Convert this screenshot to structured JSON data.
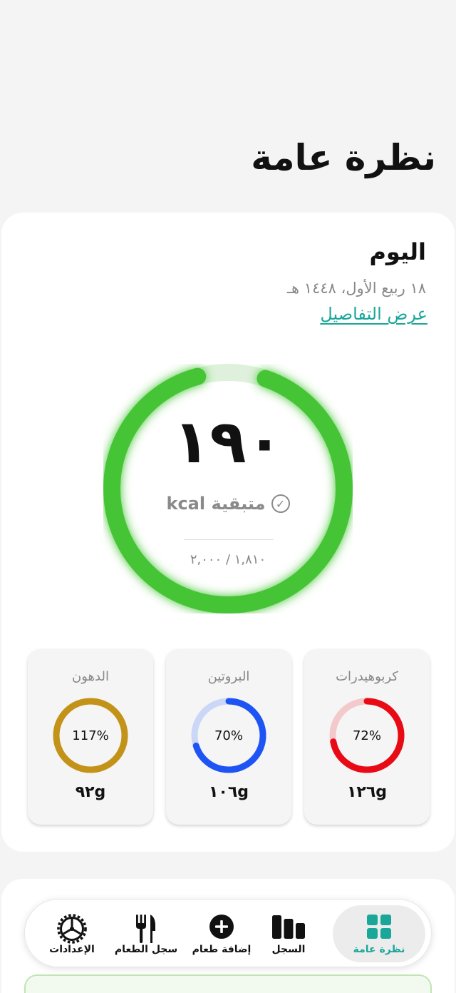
{
  "page": {
    "title": "نظرة عامة"
  },
  "today": {
    "title": "اليوم",
    "date": "١٨ ربيع الأول، ١٤٤٨ هـ",
    "details_link": "عرض التفاصيل"
  },
  "calories": {
    "remaining": "١٩٠",
    "remaining_label": "متبقية kcal",
    "consumed_total": "١,٨١٠ / ٢,٠٠٠",
    "consumed_fraction": 0.905,
    "color": "#44c535",
    "track_color": "#dff1dc"
  },
  "macros": [
    {
      "label": "كربوهيدرات",
      "percent_text": "72%",
      "percent": 0.72,
      "amount": "١٢٦g",
      "color": "#e80a14",
      "track": "#f3c9cb"
    },
    {
      "label": "البروتين",
      "percent_text": "70%",
      "percent": 0.7,
      "amount": "١٠٦g",
      "color": "#1e54f3",
      "track": "#cbd7f7"
    },
    {
      "label": "الدهون",
      "percent_text": "117%",
      "percent": 1.0,
      "amount": "٩٢g",
      "color": "#c39218",
      "track": "#ecdcb3"
    }
  ],
  "tabs": [
    {
      "label": "نظرة عامة",
      "icon": "grid-icon",
      "active": true
    },
    {
      "label": "السجل",
      "icon": "bars-icon",
      "active": false
    },
    {
      "label": "إضافة طعام",
      "icon": "plus-circle-icon",
      "active": false
    },
    {
      "label": "سجل الطعام",
      "icon": "fork-knife-icon",
      "active": false
    },
    {
      "label": "الإعدادات",
      "icon": "gear-icon",
      "active": false
    }
  ],
  "colors": {
    "accent": "#1aa79a"
  }
}
